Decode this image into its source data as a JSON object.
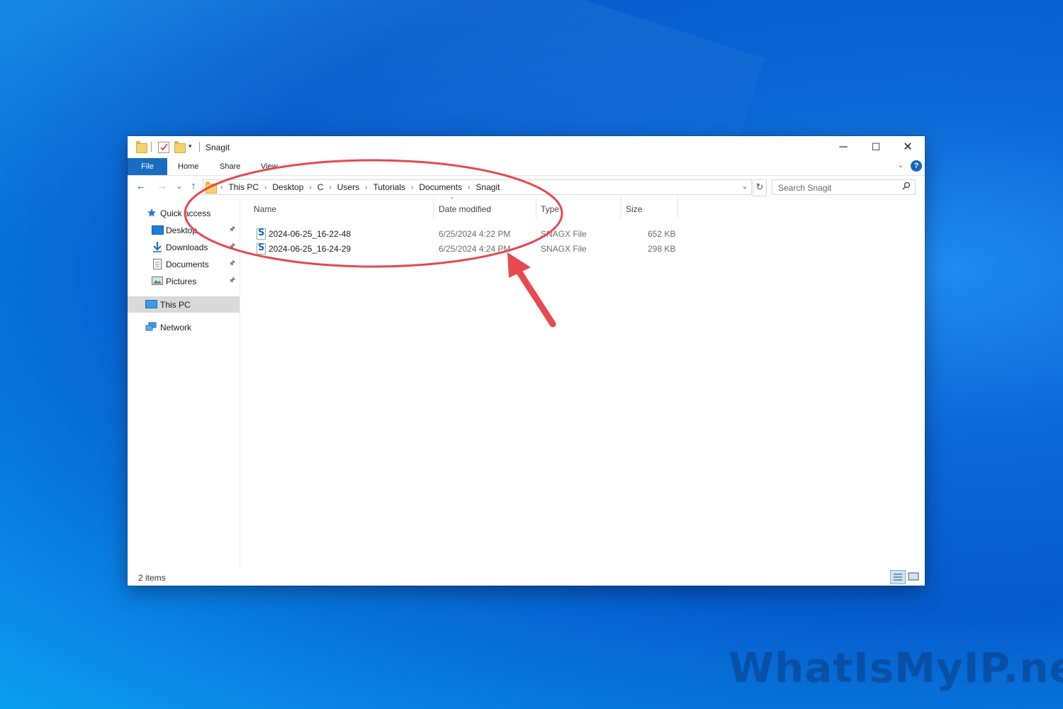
{
  "window": {
    "title": "Snagit",
    "controls": {
      "minimize": "─",
      "maximize": "☐",
      "close": "✕"
    }
  },
  "ribbon": {
    "tabs": [
      "File",
      "Home",
      "Share",
      "View"
    ],
    "help": "?",
    "expand": "⌄"
  },
  "nav": {
    "back": "←",
    "forward": "→",
    "recent": "⌄",
    "up": "↑",
    "breadcrumb": [
      "This PC",
      "Desktop",
      "C",
      "Users",
      "Tutorials",
      "Documents",
      "Snagit"
    ],
    "breadcrumb_sep": "›",
    "dropdown": "⌄",
    "refresh": "↻",
    "search_placeholder": "Search Snagit"
  },
  "navpane": {
    "quick_access": "Quick access",
    "items": [
      {
        "label": "Desktop",
        "icon": "desktop-icon",
        "pinned": true
      },
      {
        "label": "Downloads",
        "icon": "download-arrow-icon",
        "pinned": true
      },
      {
        "label": "Documents",
        "icon": "documents-icon",
        "pinned": true
      },
      {
        "label": "Pictures",
        "icon": "pictures-icon",
        "pinned": true
      }
    ],
    "this_pc": "This PC",
    "network": "Network",
    "pin_glyph": "📌"
  },
  "columns": [
    "Name",
    "Date modified",
    "Type",
    "Size"
  ],
  "files": [
    {
      "name": "2024-06-25_16-22-48",
      "date": "6/25/2024 4:22 PM",
      "type": "SNAGX File",
      "size": "652 KB",
      "icon": "snagit-file-icon"
    },
    {
      "name": "2024-06-25_16-24-29",
      "date": "6/25/2024 4:24 PM",
      "type": "SNAGX File",
      "size": "298 KB",
      "icon": "snagit-file-icon"
    }
  ],
  "status": {
    "items": "2 items"
  },
  "annotation": {
    "color": "#e8484f"
  },
  "watermark": "WhatIsMyIP.net"
}
